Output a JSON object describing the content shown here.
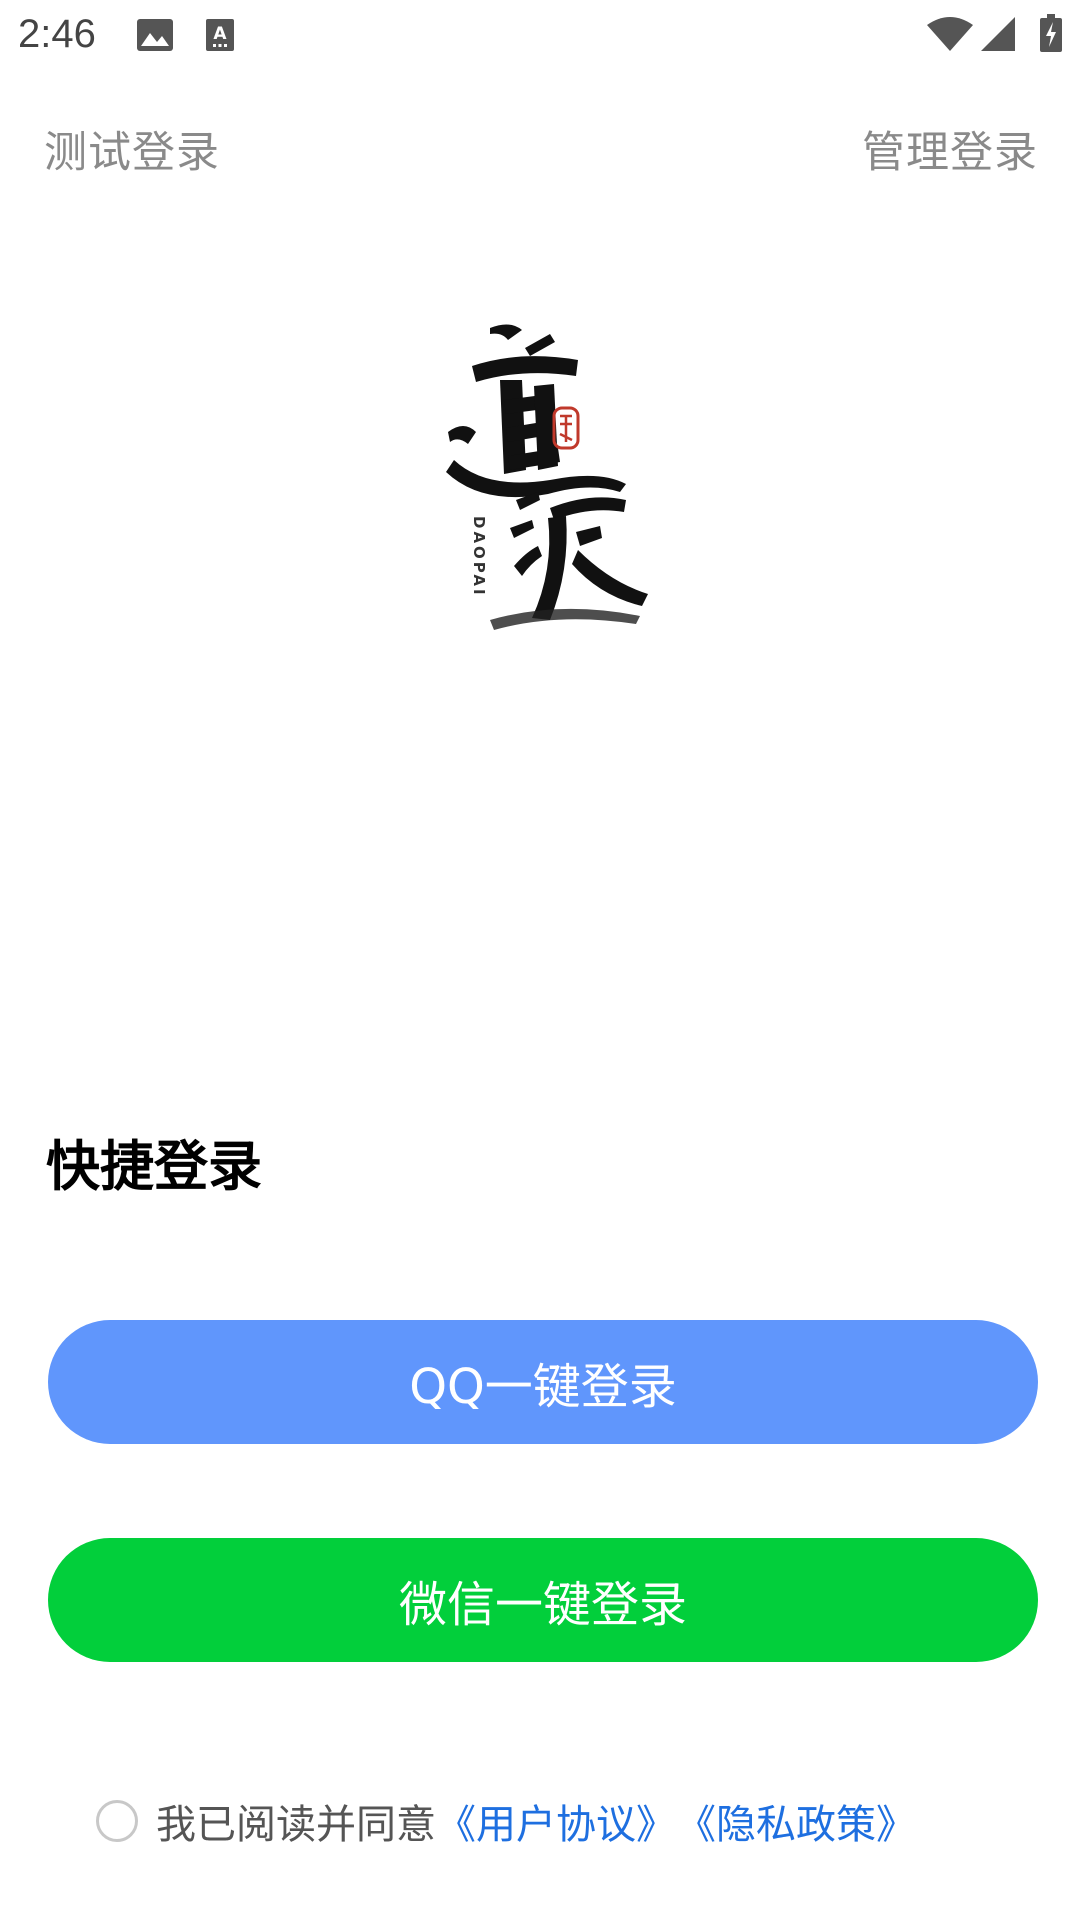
{
  "status_bar": {
    "time": "2:46",
    "icons": [
      "image-icon",
      "text-a-icon",
      "wifi-icon",
      "signal-icon",
      "battery-charging-icon"
    ]
  },
  "header": {
    "test_login": "测试登录",
    "admin_login": "管理登录"
  },
  "logo": {
    "name": "daopai-logo",
    "latin": "DAOPAI"
  },
  "quick_login": {
    "title": "快捷登录",
    "qq_button": "QQ一键登录",
    "wechat_button": "微信一键登录"
  },
  "agreement": {
    "text": "我已阅读并同意",
    "user_agreement": "《用户协议》",
    "privacy_policy": "《隐私政策》",
    "checked": false
  },
  "colors": {
    "qq": "#6096fc",
    "wechat": "#02cf3b",
    "link": "#1e6fe0",
    "muted": "#8a8a8a"
  }
}
